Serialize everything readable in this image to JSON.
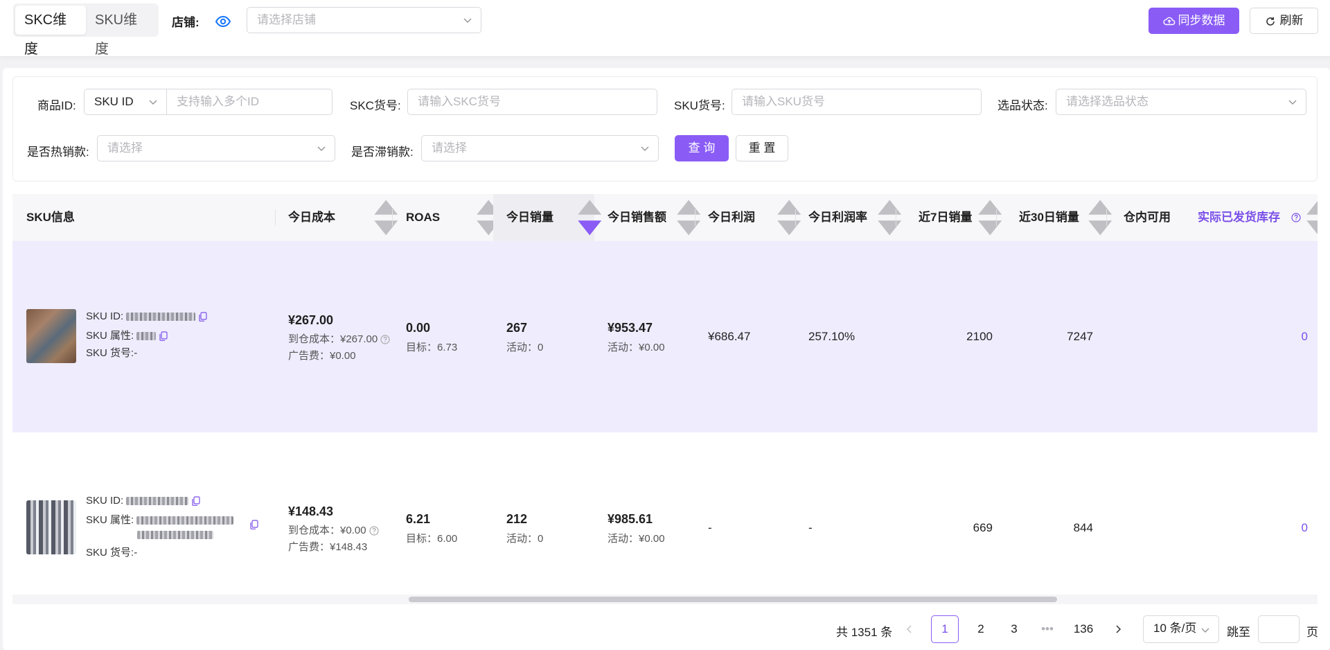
{
  "header": {
    "tabs": [
      "SKC维度",
      "SKU维度"
    ],
    "shop_label": "店铺:",
    "shop_placeholder": "请选择店铺",
    "sync_label": "同步数据",
    "refresh_label": "刷新"
  },
  "filters": {
    "product_id_label": "商品ID:",
    "product_id_type": "SKU ID",
    "product_id_placeholder": "支持输入多个ID",
    "skc_label": "SKC货号:",
    "skc_placeholder": "请输入SKC货号",
    "sku_label": "SKU货号:",
    "sku_placeholder": "请输入SKU货号",
    "status_label": "选品状态:",
    "status_placeholder": "请选择选品状态",
    "hot_label": "是否热销款:",
    "hot_placeholder": "请选择",
    "slow_label": "是否滞销款:",
    "slow_placeholder": "请选择",
    "query_label": "查 询",
    "reset_label": "重 置"
  },
  "table": {
    "columns": [
      "SKU信息",
      "今日成本",
      "ROAS",
      "今日销量",
      "今日销售额",
      "今日利润",
      "今日利润率",
      "近7日销量",
      "近30日销量",
      "仓内可用",
      "实际已发货库存"
    ],
    "rows": [
      {
        "sku_id_label": "SKU ID:",
        "sku_attr_label": "SKU 属性:",
        "sku_no_label": "SKU 货号:",
        "sku_no": "-",
        "cost": "¥267.00",
        "cost_to_warehouse": "到仓成本：¥267.00",
        "ad_fee": "广告费：¥0.00",
        "roas": "0.00",
        "roas_target": "目标：6.73",
        "sales": "267",
        "sales_activity": "活动：0",
        "revenue": "¥953.47",
        "revenue_activity": "活动：¥0.00",
        "profit": "¥686.47",
        "profit_rate": "257.10%",
        "sales_7d": "2100",
        "sales_30d": "7247",
        "shipped_stock": "0"
      },
      {
        "sku_id_label": "SKU ID:",
        "sku_attr_label": "SKU 属性:",
        "sku_no_label": "SKU 货号:",
        "sku_no": "-",
        "cost": "¥148.43",
        "cost_to_warehouse": "到仓成本：¥0.00",
        "ad_fee": "广告费：¥148.43",
        "roas": "6.21",
        "roas_target": "目标：6.00",
        "sales": "212",
        "sales_activity": "活动：0",
        "revenue": "¥985.61",
        "revenue_activity": "活动：¥0.00",
        "profit": "-",
        "profit_rate": "-",
        "sales_7d": "669",
        "sales_30d": "844",
        "shipped_stock": "0"
      }
    ]
  },
  "pagination": {
    "total": "共 1351 条",
    "pages": [
      "1",
      "2",
      "3",
      "•••",
      "136"
    ],
    "page_size": "10 条/页",
    "jump_label": "跳至",
    "page_suffix": "页"
  },
  "colors": {
    "accent": "#8a5cf5",
    "row_highlight": "#efecfd",
    "eye_icon": "#1677ff"
  }
}
